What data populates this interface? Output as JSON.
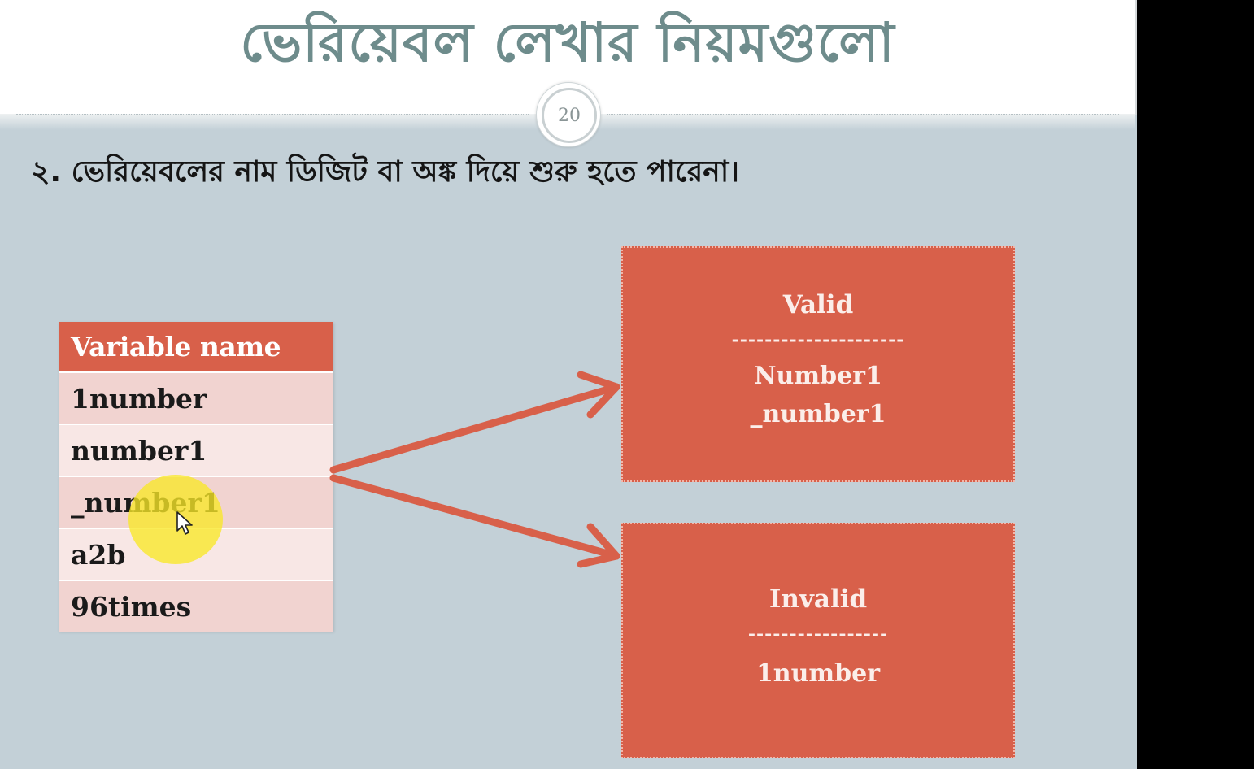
{
  "slide": {
    "title": "ভেরিয়েবল লেখার নিয়মগুলো",
    "page_number": "20",
    "subtitle": "২. ভেরিয়েবলের নাম ডিজিট বা অঙ্ক দিয়ে শুরু হতে পারেনা।"
  },
  "table": {
    "header": "Variable name",
    "rows": [
      "1number",
      "number1",
      "_number1",
      "a2b",
      "96times"
    ]
  },
  "valid_box": {
    "heading": "Valid",
    "separator": "---------------------",
    "values": [
      "Number1",
      "_number1"
    ]
  },
  "invalid_box": {
    "heading": "Invalid",
    "separator": "-----------------",
    "values": [
      "1number"
    ]
  },
  "colors": {
    "slide_background": "#c3d0d7",
    "title_color": "#6e8c8c",
    "accent": "#d8604a",
    "row_odd": "#f1d3d0",
    "row_even": "#f8e7e5",
    "cursor_highlight": "#f8e828"
  },
  "icons": [
    "arrow-cursor-icon",
    "arrow-right-icon"
  ]
}
